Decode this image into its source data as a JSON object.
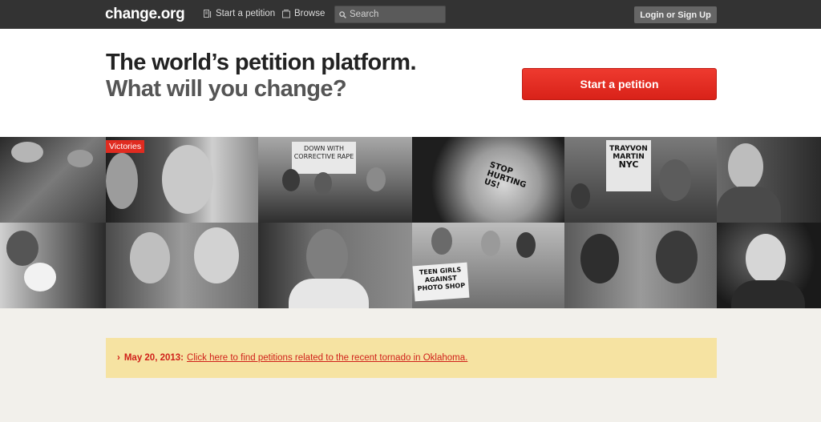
{
  "nav": {
    "logo": "change.org",
    "start_petition": "Start a petition",
    "browse": "Browse",
    "search_placeholder": "Search",
    "login": "Login or Sign Up"
  },
  "hero": {
    "headline_line1": "The world’s petition platform.",
    "headline_line2": "What will you change?",
    "cta": "Start a petition"
  },
  "mosaic": {
    "badge": "Victories",
    "signs": [
      "DOWN WITH CORRECTIVE RAPE",
      "STOP HURTING US!",
      "TRAYVON MARTIN",
      "NYC",
      "TEEN GIRLS AGAINST PHOTO SHOP"
    ]
  },
  "notice": {
    "date": "May 20, 2013:",
    "link": "Click here to find petitions related to the recent tornado in Oklahoma."
  },
  "colors": {
    "brand_red": "#d92219",
    "topbar": "#333333",
    "notice_bg": "#f6e3a2"
  }
}
